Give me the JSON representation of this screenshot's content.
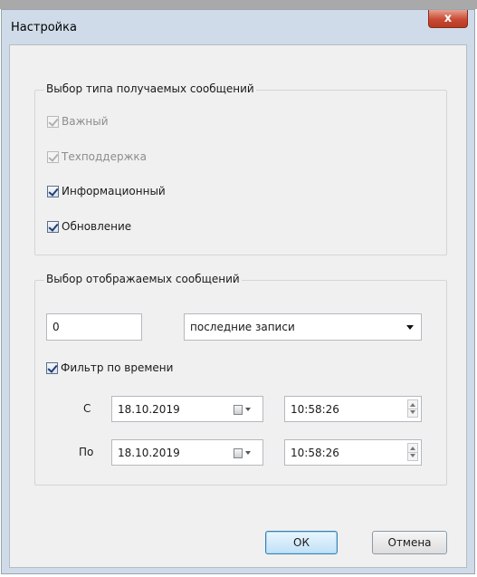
{
  "window": {
    "title": "Настройка",
    "close_glyph": "x"
  },
  "message_types_group": {
    "legend": "Выбор типа получаемых сообщений",
    "items": [
      {
        "label": "Важный",
        "checked": true,
        "enabled": false
      },
      {
        "label": "Техподдержка",
        "checked": true,
        "enabled": false
      },
      {
        "label": "Информационный",
        "checked": true,
        "enabled": true
      },
      {
        "label": "Обновление",
        "checked": true,
        "enabled": true
      }
    ]
  },
  "display_group": {
    "legend": "Выбор отображаемых сообщений",
    "count_value": "0",
    "mode_value": "последние записи",
    "time_filter": {
      "label": "Фильтр по времени",
      "checked": true
    },
    "from": {
      "label": "С",
      "date": "18.10.2019",
      "time": "10:58:26"
    },
    "to": {
      "label": "По",
      "date": "18.10.2019",
      "time": "10:58:26"
    }
  },
  "buttons": {
    "ok": "ОК",
    "cancel": "Отмена"
  }
}
